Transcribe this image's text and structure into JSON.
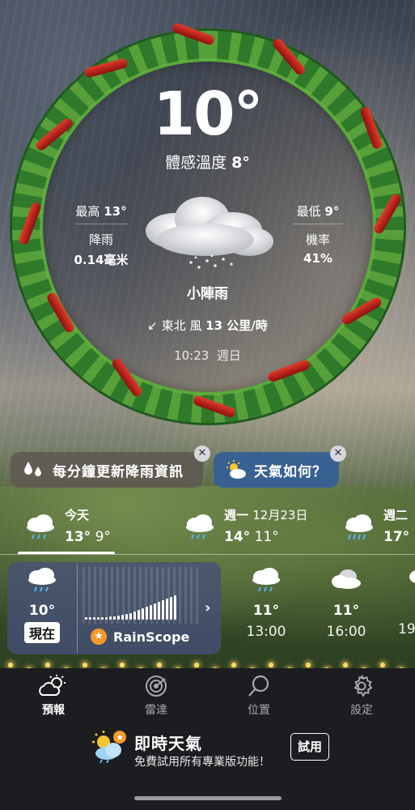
{
  "current": {
    "temperature": "10°",
    "feels_like_label": "體感溫度",
    "feels_like_value": "8°",
    "high_label": "最高",
    "high_value": "13°",
    "low_label": "最低",
    "low_value": "9°",
    "precip_label": "降雨",
    "precip_value": "0.14毫米",
    "chance_label": "機率",
    "chance_value": "41%",
    "condition": "小陣雨",
    "wind_arrow": "↙",
    "wind_dir": "東北 風",
    "wind_speed": "13 公里/時",
    "time": "10:23",
    "weekday": "週日"
  },
  "chips": [
    {
      "label": "每分鐘更新降雨資訊",
      "icon": "raindrops-icon"
    },
    {
      "label": "天氣如何？",
      "icon": "partly-sunny-icon"
    }
  ],
  "daily": [
    {
      "name": "今天",
      "date": "",
      "high": "13°",
      "low": "9°",
      "icon": "rain-cloud-icon"
    },
    {
      "name": "週一",
      "date": "12月23日",
      "high": "14°",
      "low": "11°",
      "icon": "rain-cloud-icon"
    },
    {
      "name": "週二",
      "date": "",
      "high": "17°",
      "low": "",
      "icon": "heavy-rain-cloud-icon"
    }
  ],
  "hourly_now": {
    "temp": "10°",
    "badge": "現在",
    "rainscope_label": "RainScope"
  },
  "hourly": [
    {
      "temp": "11°",
      "hour": "13:00",
      "icon": "rain-cloud-icon"
    },
    {
      "temp": "11°",
      "hour": "16:00",
      "icon": "cloudy-icon"
    },
    {
      "temp": "",
      "hour": "19",
      "icon": "rain-cloud-icon"
    }
  ],
  "rain_bars": [
    3,
    3,
    3,
    3,
    3,
    3,
    4,
    4,
    5,
    6,
    7,
    8,
    10,
    12,
    14,
    16,
    18,
    20,
    22,
    24,
    26,
    28,
    30
  ],
  "tabs": [
    "預報",
    "雷達",
    "位置",
    "設定"
  ],
  "promo": {
    "title": "即時天氣",
    "subtitle": "免費試用所有專業版功能！",
    "button": "試用"
  },
  "colors": {
    "chip_blue": "#3660a0",
    "chip_brown": "#5f5a52",
    "accent_orange": "#f39a2a",
    "tabbar": "#1c1d20"
  }
}
